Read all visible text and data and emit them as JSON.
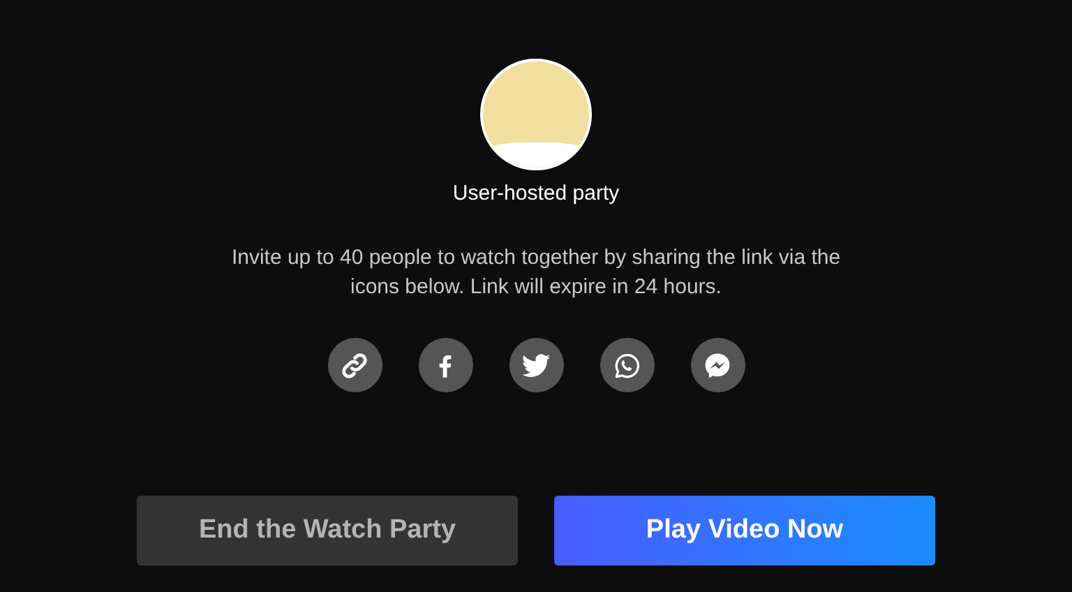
{
  "host": {
    "name": "User-hosted party"
  },
  "description": "Invite up to 40 people to watch together by sharing the link via the icons below. Link will expire in 24 hours.",
  "share_buttons": [
    {
      "kind": "link"
    },
    {
      "kind": "facebook"
    },
    {
      "kind": "twitter"
    },
    {
      "kind": "whatsapp"
    },
    {
      "kind": "messenger"
    }
  ],
  "buttons": [
    {
      "kind": "secondary",
      "label": "End the Watch Party"
    },
    {
      "kind": "primary",
      "label": "Play Video Now"
    }
  ]
}
